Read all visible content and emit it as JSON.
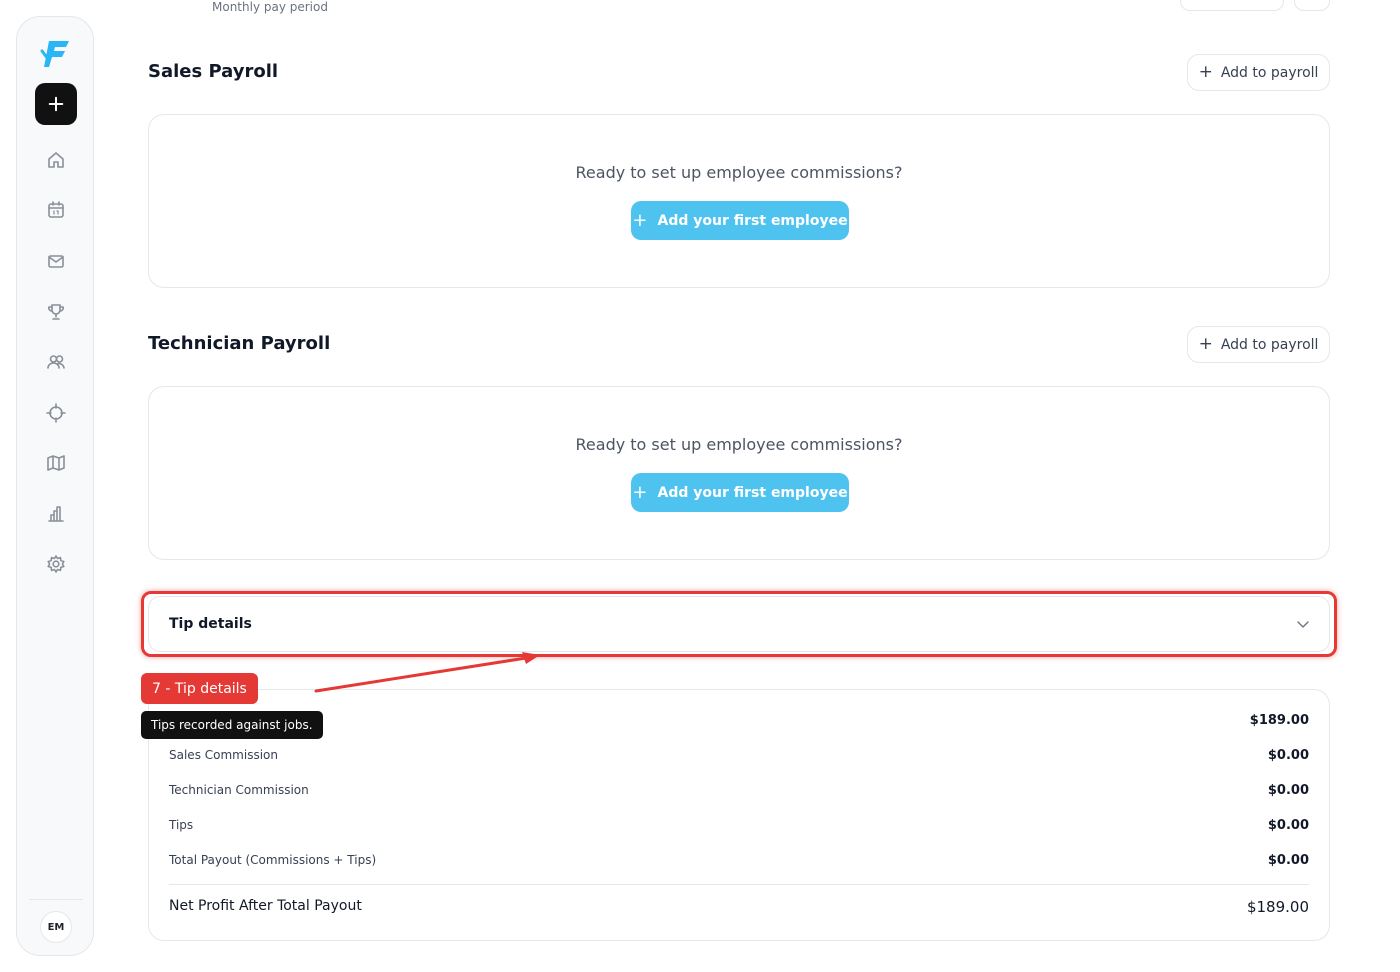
{
  "header": {
    "subtitle": "Monthly pay period"
  },
  "sidebar": {
    "logo": "fieldbase-logo",
    "add_button_icon": "plus-icon",
    "nav": [
      "home-icon",
      "calendar-icon",
      "mail-icon",
      "trophy-icon",
      "users-icon",
      "target-icon",
      "map-icon",
      "chart-icon",
      "settings-icon"
    ],
    "avatar": "EM"
  },
  "sales": {
    "title": "Sales Payroll",
    "add_label": "Add to payroll",
    "empty_text": "Ready to set up employee commissions?",
    "cta_label": "Add your first employee"
  },
  "technician": {
    "title": "Technician Payroll",
    "add_label": "Add to payroll",
    "empty_text": "Ready to set up employee commissions?",
    "cta_label": "Add your first employee"
  },
  "tips": {
    "title": "Tip details",
    "annotation_label": "7 - Tip details",
    "tooltip": "Tips recorded against jobs."
  },
  "summary": {
    "rows": [
      {
        "label": "",
        "value": "$189.00"
      },
      {
        "label": "Sales Commission",
        "value": "$0.00"
      },
      {
        "label": "Technician Commission",
        "value": "$0.00"
      },
      {
        "label": "Tips",
        "value": "$0.00"
      },
      {
        "label": "Total Payout (Commissions + Tips)",
        "value": "$0.00"
      }
    ],
    "net_label": "Net Profit After Total Payout",
    "net_value": "$189.00"
  },
  "colors": {
    "accent": "#4fc3f0",
    "annotation": "#e53935",
    "logo": "#29b6f6"
  }
}
